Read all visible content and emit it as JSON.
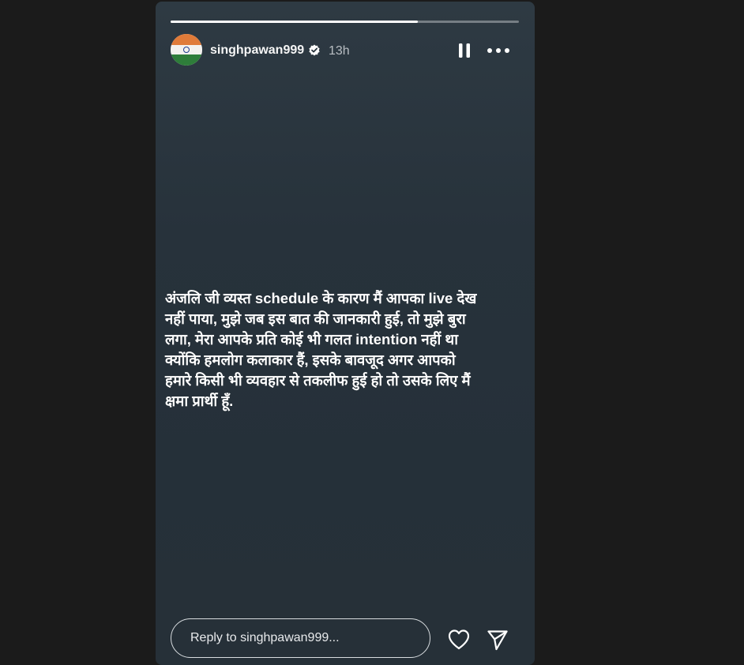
{
  "story": {
    "progress_fraction": 0.71,
    "author": {
      "username": "singhpawan999",
      "verified": true,
      "avatar": "indian-flag-avatar"
    },
    "posted_ago": "13h",
    "controls": {
      "pause_icon": "pause-icon",
      "more_icon": "more-options-icon"
    },
    "caption": "अंजलि जी व्यस्त schedule के कारण मैं आपका live देख\nनहीं पाया,  मुझे जब इस बात की जानकारी हुई,  तो मुझे बुरा\nलगा,  मेरा आपके प्रति कोई भी गलत intention नहीं था\nक्योंकि हमलोग कलाकार हैं,  इसके बावजूद अगर आपको\nहमारे  किसी भी व्यवहार से तकलीफ हुई हो तो उसके लिए मैं\nक्षमा प्रार्थी हूँ.",
    "reply": {
      "placeholder": "Reply to singhpawan999...",
      "value": ""
    },
    "actions": {
      "like_icon": "heart-icon",
      "share_icon": "send-icon"
    }
  },
  "colors": {
    "background": "#1b1b1b",
    "story_bg": "#27323b",
    "text": "#ffffff",
    "muted": "#b9bec3"
  }
}
